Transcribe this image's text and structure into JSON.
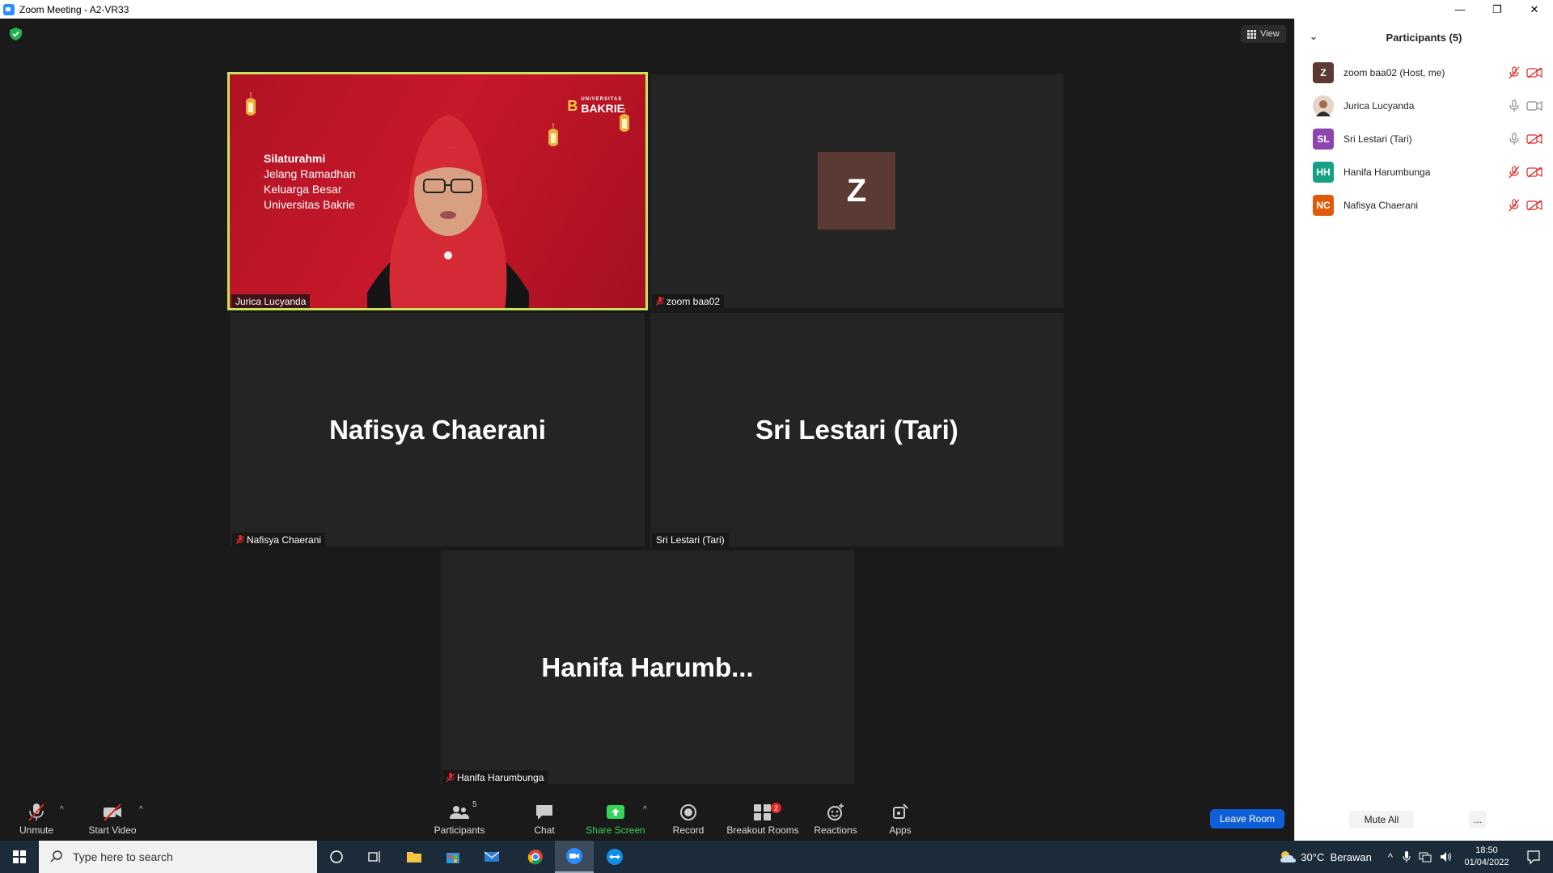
{
  "window": {
    "title": "Zoom Meeting - A2-VR33",
    "minimize": "—",
    "restore": "❐",
    "close": "✕"
  },
  "meeting": {
    "view_label": "View",
    "tiles": [
      {
        "name": "Jurica Lucyanda",
        "big_name": "",
        "muted": false
      },
      {
        "name": "zoom baa02",
        "big_name": "",
        "avatar_initial": "Z",
        "muted": true
      },
      {
        "name": "Nafisya Chaerani",
        "big_name": "Nafisya Chaerani",
        "muted": true
      },
      {
        "name": "Sri Lestari (Tari)",
        "big_name": "Sri Lestari (Tari)",
        "muted": false
      },
      {
        "name": "Hanifa Harumbunga",
        "big_name": "Hanifa  Harumb...",
        "muted": true
      }
    ],
    "banner": {
      "line1": "Silaturahmi",
      "line2": "Jelang Ramadhan",
      "line3": "Keluarga Besar",
      "line4": "Universitas Bakrie",
      "logo_mark": "B",
      "logo_small": "UNIVERSITAS",
      "logo_text": "BAKRIE"
    }
  },
  "toolbar": {
    "unmute": "Unmute",
    "start_video": "Start Video",
    "participants": "Participants",
    "participants_count": "5",
    "chat": "Chat",
    "share_screen": "Share Screen",
    "record": "Record",
    "breakout_rooms": "Breakout Rooms",
    "breakout_badge": "2",
    "reactions": "Reactions",
    "apps": "Apps",
    "caret": "^",
    "leave_room": "Leave Room"
  },
  "participants_panel": {
    "title": "Participants (5)",
    "list": [
      {
        "initials": "Z",
        "name": "zoom baa02 (Host, me)",
        "color": "#5a3a32",
        "mic": "muted",
        "cam": "off"
      },
      {
        "initials": "",
        "name": "Jurica Lucyanda",
        "color": "#c9a08a",
        "mic": "on",
        "cam": "on"
      },
      {
        "initials": "SL",
        "name": "Sri Lestari (Tari)",
        "color": "#8e44ad",
        "mic": "on",
        "cam": "off"
      },
      {
        "initials": "HH",
        "name": "Hanifa Harumbunga",
        "color": "#16a085",
        "mic": "muted",
        "cam": "off"
      },
      {
        "initials": "NC",
        "name": "Nafisya Chaerani",
        "color": "#e05a0c",
        "mic": "muted",
        "cam": "off"
      }
    ],
    "mute_all": "Mute All",
    "more": "..."
  },
  "taskbar": {
    "search_placeholder": "Type here to search",
    "weather": "30°C  Berawan",
    "time": "18:50",
    "date": "01/04/2022"
  },
  "colors": {
    "active_speaker_border": "#cbe35a",
    "leave_button": "#0e5fd8",
    "share_green": "#35d35a",
    "muted_red": "#e02828"
  }
}
